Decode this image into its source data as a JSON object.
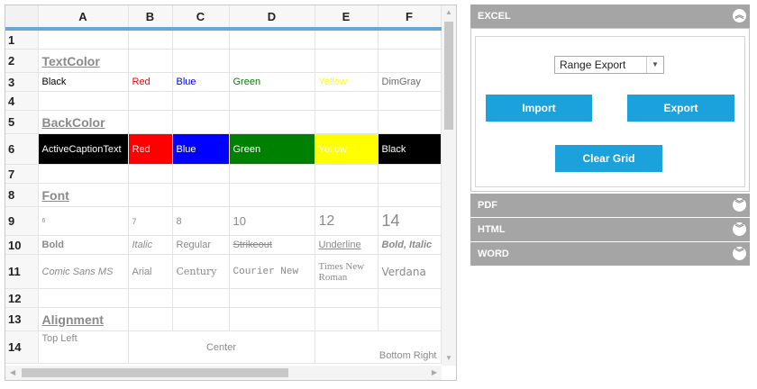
{
  "grid": {
    "columns": [
      "A",
      "B",
      "C",
      "D",
      "E",
      "F"
    ],
    "rows": [
      "1",
      "2",
      "3",
      "4",
      "5",
      "6",
      "7",
      "8",
      "9",
      "10",
      "11",
      "12",
      "13",
      "14"
    ],
    "sections": {
      "textcolor": "TextColor",
      "backcolor": "BackColor",
      "font": "Font",
      "alignment": "Alignment"
    },
    "textcolor_cells": [
      "Black",
      "Red",
      "Blue",
      "Green",
      "Yellow",
      "DimGray"
    ],
    "backcolor_cells": [
      "ActiveCaptionText",
      "Red",
      "Blue",
      "Green",
      "Yellow",
      "Black"
    ],
    "font_sizes": [
      "6",
      "7",
      "8",
      "10",
      "12",
      "14"
    ],
    "font_styles": [
      "Bold",
      "Italic",
      "Regular",
      "Strikeout",
      "Underline",
      "Bold, Italic"
    ],
    "font_families": [
      "Comic Sans MS",
      "Arial",
      "Century",
      "Courier New",
      "Times New Roman",
      "Verdana"
    ],
    "alignment_cells": {
      "top_left": "Top Left",
      "center": "Center",
      "bottom_right": "Bottom Right"
    }
  },
  "panel": {
    "excel": {
      "title": "EXCEL",
      "select_value": "Range Export",
      "import_label": "Import",
      "export_label": "Export",
      "clear_label": "Clear Grid"
    },
    "pdf": {
      "title": "PDF"
    },
    "html": {
      "title": "HTML"
    },
    "word": {
      "title": "WORD"
    }
  },
  "colors": {
    "accent": "#1ba1dc",
    "header_bar": "#a5a5a5",
    "column_rule": "#6aa6d6"
  },
  "icons": {
    "collapse": "double-chevron-up-icon",
    "expand": "double-chevron-down-icon"
  }
}
